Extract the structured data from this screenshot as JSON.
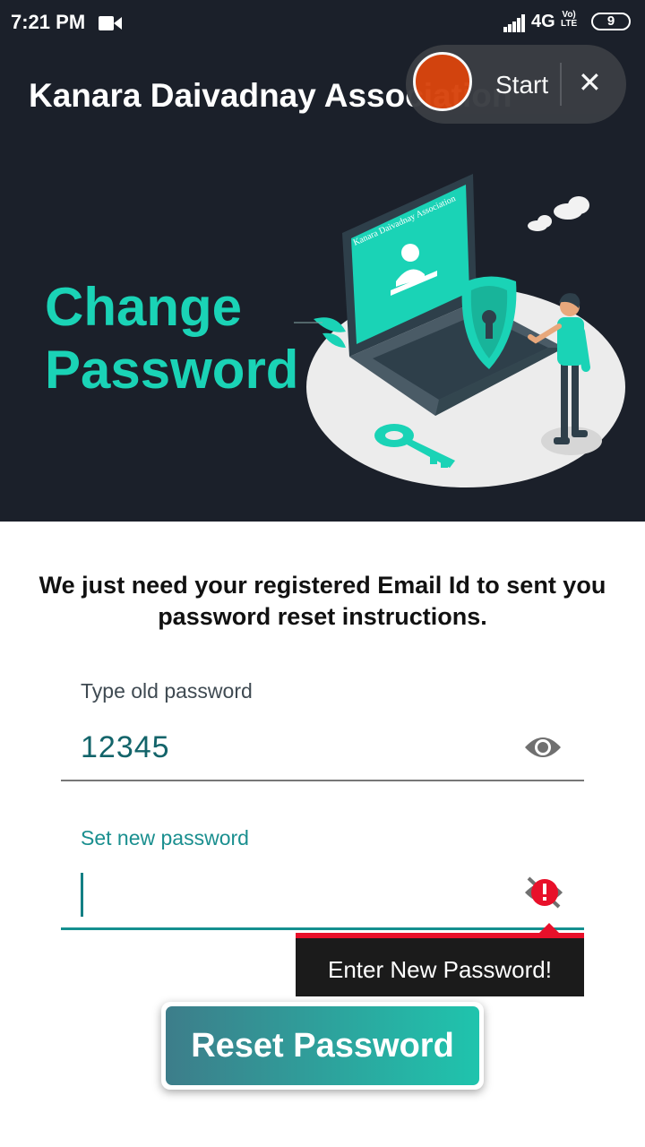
{
  "status_bar": {
    "time": "7:21 PM",
    "network": "4G",
    "volte_top": "Vo)",
    "volte_bottom": "LTE",
    "battery": "9",
    "icons": [
      "video-camera-icon",
      "signal-icon"
    ]
  },
  "app_bar": {
    "title": "Kanara Daivadnay Association"
  },
  "screen_recorder": {
    "start_label": "Start",
    "close_label": "✕"
  },
  "hero": {
    "title_line1": "Change",
    "title_line2": "Password",
    "illustration_screen_text": "Kanara Daivadnay Association"
  },
  "form": {
    "instructions": "We just need your registered Email Id to sent you password reset instructions.",
    "old_password_label": "Type old password",
    "old_password_value": "12345",
    "new_password_label": "Set new password",
    "new_password_value": "",
    "error_message": "Enter New Password!",
    "submit_label": "Reset Password"
  },
  "colors": {
    "dark_background": "#1b202a",
    "accent_teal": "#1ad3b6",
    "error_red": "#e8102a",
    "record_orange": "#d8450e"
  }
}
